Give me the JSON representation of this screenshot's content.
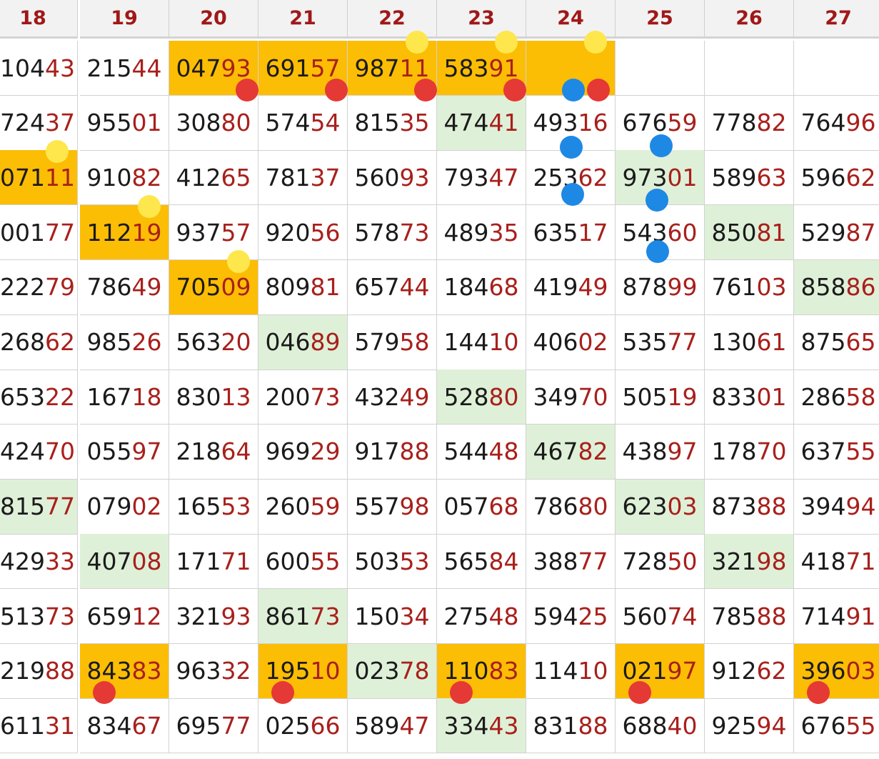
{
  "columns": [
    "18",
    "19",
    "20",
    "21",
    "22",
    "23",
    "24",
    "25",
    "26",
    "27"
  ],
  "rows": [
    [
      "10443",
      "21544",
      "04793",
      "69157",
      "98711",
      "58391",
      "",
      "",
      "",
      ""
    ],
    [
      "72437",
      "95501",
      "30880",
      "57454",
      "81535",
      "47441",
      "49316",
      "67659",
      "77882",
      "76496"
    ],
    [
      "07111",
      "91082",
      "41265",
      "78137",
      "56093",
      "79347",
      "25362",
      "97301",
      "58963",
      "59662"
    ],
    [
      "00177",
      "11219",
      "93757",
      "92056",
      "57873",
      "48935",
      "63517",
      "54360",
      "85081",
      "52987"
    ],
    [
      "22279",
      "78649",
      "70509",
      "80981",
      "65744",
      "18468",
      "41949",
      "87899",
      "76103",
      "85886"
    ],
    [
      "26862",
      "98526",
      "56320",
      "04689",
      "57958",
      "14410",
      "40602",
      "53577",
      "13061",
      "87565"
    ],
    [
      "65322",
      "16718",
      "83013",
      "20073",
      "43249",
      "52880",
      "34970",
      "50519",
      "83301",
      "28658"
    ],
    [
      "42470",
      "05597",
      "21864",
      "96929",
      "91788",
      "54448",
      "46782",
      "43897",
      "17870",
      "63755"
    ],
    [
      "81577",
      "07902",
      "16553",
      "26059",
      "55798",
      "05768",
      "78680",
      "62303",
      "87388",
      "39494"
    ],
    [
      "42933",
      "40708",
      "17171",
      "60055",
      "50353",
      "56584",
      "38877",
      "72850",
      "32198",
      "41871"
    ],
    [
      "51373",
      "65912",
      "32193",
      "86173",
      "15034",
      "27548",
      "59425",
      "56074",
      "78588",
      "71491"
    ],
    [
      "21988",
      "84383",
      "96332",
      "19510",
      "02378",
      "11083",
      "11410",
      "02197",
      "91262",
      "39603"
    ],
    [
      "61131",
      "83467",
      "69577",
      "02566",
      "58947",
      "33443",
      "83188",
      "68840",
      "92594",
      "67655"
    ]
  ],
  "highlights": {
    "orange": [
      [
        0,
        2
      ],
      [
        0,
        3
      ],
      [
        0,
        4
      ],
      [
        0,
        5
      ],
      [
        0,
        6
      ],
      [
        2,
        0
      ],
      [
        3,
        1
      ],
      [
        4,
        2
      ],
      [
        11,
        1
      ],
      [
        11,
        3
      ],
      [
        11,
        5
      ],
      [
        11,
        7
      ],
      [
        11,
        9
      ]
    ],
    "green": [
      [
        1,
        5
      ],
      [
        2,
        7
      ],
      [
        3,
        8
      ],
      [
        4,
        9
      ],
      [
        5,
        3
      ],
      [
        6,
        5
      ],
      [
        7,
        6
      ],
      [
        8,
        0
      ],
      [
        8,
        7
      ],
      [
        9,
        1
      ],
      [
        9,
        8
      ],
      [
        10,
        3
      ],
      [
        11,
        4
      ],
      [
        12,
        5
      ]
    ]
  },
  "markers": {
    "yellow": [
      [
        0,
        4
      ],
      [
        0,
        5
      ],
      [
        0,
        6
      ],
      [
        2,
        0
      ],
      [
        3,
        1
      ],
      [
        4,
        2
      ]
    ],
    "red": [
      [
        0,
        2
      ],
      [
        0,
        3
      ],
      [
        0,
        4
      ],
      [
        0,
        5
      ],
      [
        0,
        6
      ],
      [
        11,
        1
      ],
      [
        11,
        3
      ],
      [
        11,
        5
      ],
      [
        11,
        7
      ],
      [
        11,
        9
      ]
    ],
    "blue": [
      [
        0,
        6
      ],
      [
        1,
        6
      ],
      [
        1,
        7
      ],
      [
        2,
        6
      ],
      [
        2,
        7
      ],
      [
        3,
        7
      ]
    ]
  },
  "colors": {
    "orange_cell": "#fcbd05",
    "green_cell": "#dff0d8",
    "header_text": "#a01818",
    "digit_prefix": "#1b1b1b",
    "digit_suffix": "#a8201c",
    "yellow_marker": "#fde74c",
    "red_marker": "#e53935",
    "blue_marker": "#1e88e5"
  }
}
